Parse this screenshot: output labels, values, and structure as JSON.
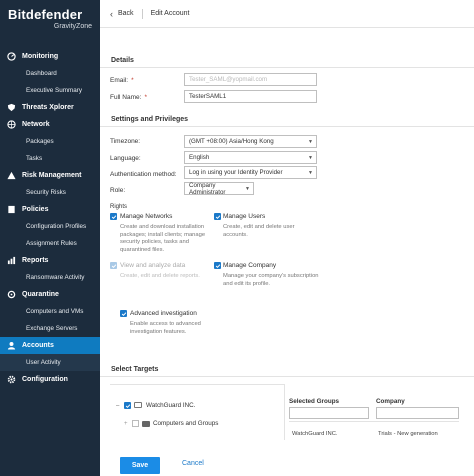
{
  "brand": {
    "name": "Bitdefender",
    "product": "GravityZone"
  },
  "nav": {
    "monitoring": "Monitoring",
    "dashboard": "Dashboard",
    "executive_summary": "Executive Summary",
    "threats_xplorer": "Threats Xplorer",
    "network": "Network",
    "packages": "Packages",
    "tasks": "Tasks",
    "risk_management": "Risk Management",
    "security_risks": "Security Risks",
    "policies": "Policies",
    "configuration_profiles": "Configuration Profiles",
    "assignment_rules": "Assignment Rules",
    "reports": "Reports",
    "ransomware_activity": "Ransomware Activity",
    "quarantine": "Quarantine",
    "computers_and_vms": "Computers and VMs",
    "exchange_servers": "Exchange Servers",
    "accounts": "Accounts",
    "user_activity": "User Activity",
    "configuration": "Configuration"
  },
  "topbar": {
    "back": "Back",
    "breadcrumb": "Edit Account"
  },
  "details": {
    "title": "Details",
    "email_label": "Email:",
    "email_value": "Tester_SAML@yopmail.com",
    "fullname_label": "Full Name:",
    "fullname_value": "TesterSAML1"
  },
  "settings": {
    "title": "Settings and Privileges",
    "timezone_label": "Timezone:",
    "timezone_value": "(GMT +08:00) Asia/Hong Kong",
    "language_label": "Language:",
    "language_value": "English",
    "auth_label": "Authentication method:",
    "auth_value": "Log in using your Identity Provider",
    "role_label": "Role:",
    "role_value": "Company Administrator"
  },
  "rights": {
    "title": "Rights",
    "manage_networks": "Manage Networks",
    "manage_networks_desc": [
      "Create and download installation",
      "packages; install clients; manage",
      "security policies, tasks and",
      "quarantined files."
    ],
    "manage_users": "Manage Users",
    "manage_users_desc": [
      "Create, edit and delete user",
      "accounts."
    ],
    "view_analyze": "View and analyze data",
    "view_analyze_desc": "Create, edit and delete reports.",
    "manage_company": "Manage Company",
    "manage_company_desc": [
      "Manage your company's subscription",
      "and edit its profile."
    ],
    "advanced_investigation": "Advanced investigation",
    "advanced_investigation_desc": [
      "Enable access to advanced",
      "investigation features."
    ]
  },
  "targets": {
    "title": "Select Targets",
    "tree_root": "WatchGuard INC.",
    "tree_child": "Computers and Groups",
    "col_groups": "Selected Groups",
    "col_company": "Company",
    "row_group": "WatchGuard INC.",
    "row_company": "Trials - New generation"
  },
  "actions": {
    "save": "Save",
    "cancel": "Cancel"
  },
  "colors": {
    "sidebar": "#1c2c3d",
    "accent": "#0f7bc0",
    "checkbox": "#1b79c9",
    "required": "#c0392b"
  }
}
